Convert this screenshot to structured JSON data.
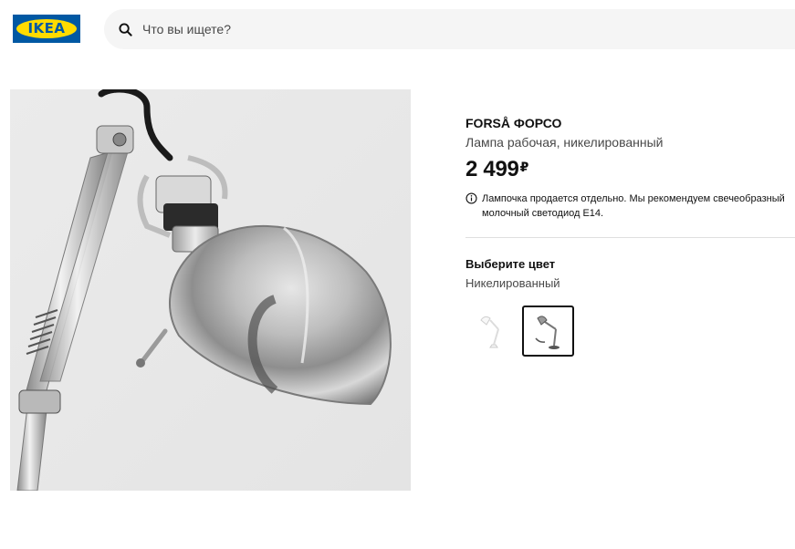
{
  "header": {
    "logo_text": "IKEA",
    "search": {
      "placeholder": "Что вы ищете?"
    }
  },
  "product": {
    "name": "FORSÅ ФОРСО",
    "description": "Лампа рабочая, никелированный",
    "price": "2 499",
    "currency": "₽",
    "notice": "Лампочка продается отдельно. Мы рекомендуем свечеобразный молочный светодиод E14."
  },
  "color_selection": {
    "heading": "Выберите цвет",
    "selected_color": "Никелированный",
    "options": [
      {
        "color_name": "white",
        "selected": false
      },
      {
        "color_name": "nickel-plated",
        "selected": true
      }
    ]
  },
  "colors": {
    "brand_blue": "#0058a3",
    "brand_yellow": "#ffdb00"
  }
}
